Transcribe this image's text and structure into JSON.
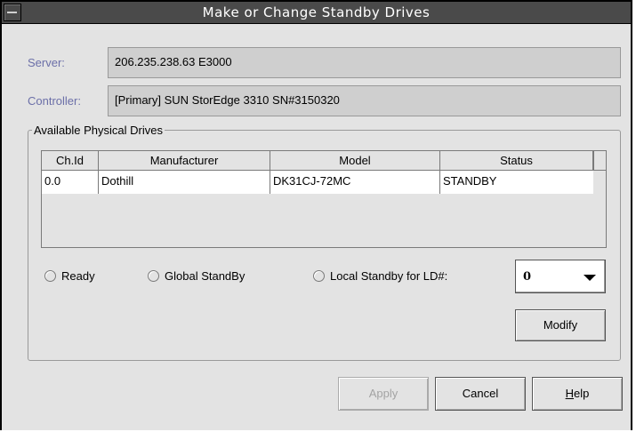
{
  "window": {
    "title": "Make or Change Standby Drives"
  },
  "server": {
    "label": "Server:",
    "value": "206.235.238.63 E3000"
  },
  "controller": {
    "label": "Controller:",
    "value": "[Primary] SUN StorEdge 3310 SN#3150320"
  },
  "drives_group": {
    "label": "Available Physical Drives",
    "columns": [
      "Ch.Id",
      "Manufacturer",
      "Model",
      "Status"
    ],
    "rows": [
      {
        "ch_id": "0.0",
        "manufacturer": "Dothill",
        "model": "DK31CJ-72MC",
        "status": "STANDBY"
      }
    ]
  },
  "options": {
    "ready": "Ready",
    "global_standby": "Global StandBy",
    "local_standby": "Local Standby for LD#:",
    "ld_value": "0"
  },
  "buttons": {
    "modify": "Modify",
    "apply": "Apply",
    "cancel": "Cancel",
    "help_accel": "H",
    "help_rest": "elp"
  },
  "colors": {
    "title_bar": "#4a4a4a",
    "label_accent": "#6b6fa8",
    "window_bg": "#e3e3e3"
  }
}
